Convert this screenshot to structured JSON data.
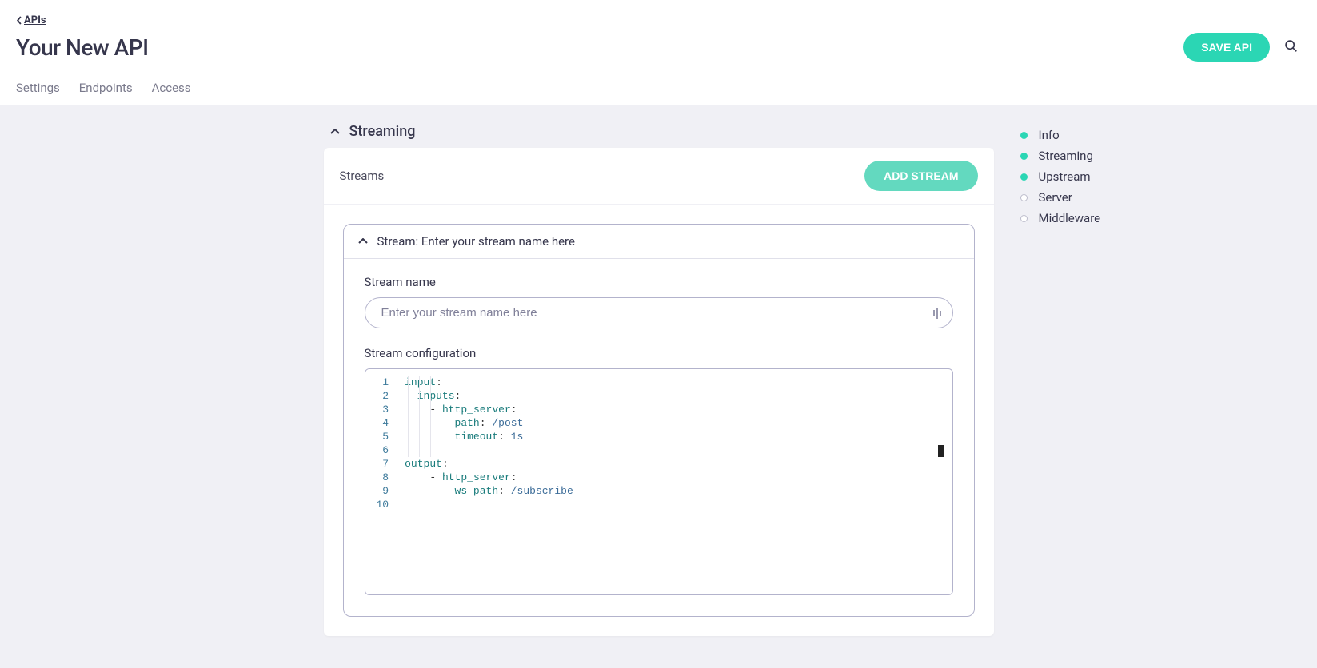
{
  "breadcrumb": {
    "label": "APIs"
  },
  "page": {
    "title": "Your New API"
  },
  "actions": {
    "save_label": "SAVE API"
  },
  "tabs": [
    {
      "label": "Settings"
    },
    {
      "label": "Endpoints"
    },
    {
      "label": "Access"
    }
  ],
  "section": {
    "title": "Streaming"
  },
  "streams": {
    "label": "Streams",
    "add_label": "ADD STREAM"
  },
  "stream": {
    "header_prefix": "Stream: ",
    "header_name": "Enter your stream name here",
    "name_label": "Stream name",
    "name_placeholder": "Enter your stream name here",
    "name_value": "",
    "config_label": "Stream configuration",
    "code": {
      "line_numbers": [
        "1",
        "2",
        "3",
        "4",
        "5",
        "6",
        "7",
        "8",
        "9",
        "10"
      ],
      "lines": [
        {
          "indent": 0,
          "tokens": [
            {
              "t": "k",
              "s": "input"
            },
            {
              "t": "p",
              "s": ":"
            }
          ]
        },
        {
          "indent": 1,
          "tokens": [
            {
              "t": "k",
              "s": "inputs"
            },
            {
              "t": "p",
              "s": ":"
            }
          ]
        },
        {
          "indent": 2,
          "tokens": [
            {
              "t": "d",
              "s": "- "
            },
            {
              "t": "k",
              "s": "http_server"
            },
            {
              "t": "p",
              "s": ":"
            }
          ]
        },
        {
          "indent": 4,
          "tokens": [
            {
              "t": "k",
              "s": "path"
            },
            {
              "t": "p",
              "s": ": "
            },
            {
              "t": "v",
              "s": "/post"
            }
          ]
        },
        {
          "indent": 4,
          "tokens": [
            {
              "t": "k",
              "s": "timeout"
            },
            {
              "t": "p",
              "s": ": "
            },
            {
              "t": "v",
              "s": "1s"
            }
          ]
        },
        {
          "indent": 0,
          "tokens": []
        },
        {
          "indent": 0,
          "tokens": [
            {
              "t": "k",
              "s": "output"
            },
            {
              "t": "p",
              "s": ":"
            }
          ]
        },
        {
          "indent": 2,
          "tokens": [
            {
              "t": "d",
              "s": "- "
            },
            {
              "t": "k",
              "s": "http_server"
            },
            {
              "t": "p",
              "s": ":"
            }
          ]
        },
        {
          "indent": 4,
          "tokens": [
            {
              "t": "k",
              "s": "ws_path"
            },
            {
              "t": "p",
              "s": ": "
            },
            {
              "t": "v",
              "s": "/subscribe"
            }
          ]
        },
        {
          "indent": 0,
          "tokens": []
        }
      ]
    }
  },
  "sidenav": [
    {
      "label": "Info",
      "active": true
    },
    {
      "label": "Streaming",
      "active": true
    },
    {
      "label": "Upstream",
      "active": true
    },
    {
      "label": "Server",
      "active": false
    },
    {
      "label": "Middleware",
      "active": false
    }
  ]
}
